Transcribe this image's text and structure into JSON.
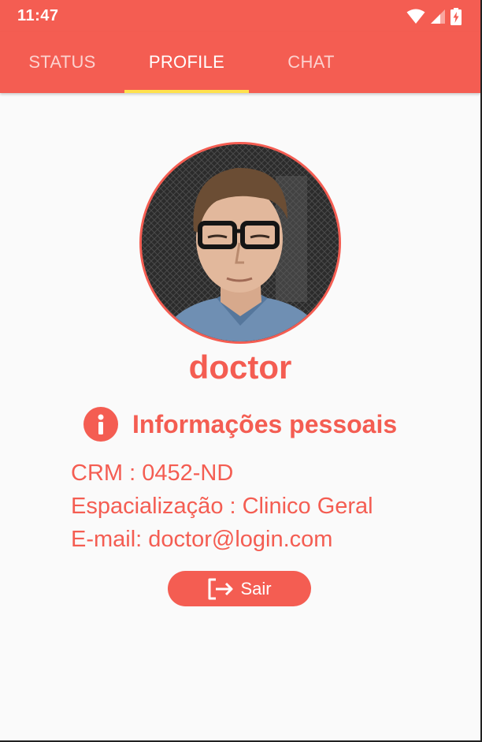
{
  "status_bar": {
    "time": "11:47",
    "icons": [
      "wifi-icon",
      "cell-signal-icon",
      "battery-charging-icon"
    ]
  },
  "tabs": [
    {
      "label": "STATUS",
      "active": false
    },
    {
      "label": "PROFILE",
      "active": true
    },
    {
      "label": "CHAT",
      "active": false
    }
  ],
  "colors": {
    "primary": "#f45d52",
    "tab_indicator": "#ffe14d",
    "background": "#fafafa"
  },
  "profile": {
    "name": "doctor",
    "info_title": "Informações pessoais",
    "details": {
      "crm": "CRM : 0452-ND",
      "specialization": "Espacialização : Clinico Geral",
      "email": "E-mail: doctor@login.com"
    },
    "logout_label": "Sair"
  }
}
